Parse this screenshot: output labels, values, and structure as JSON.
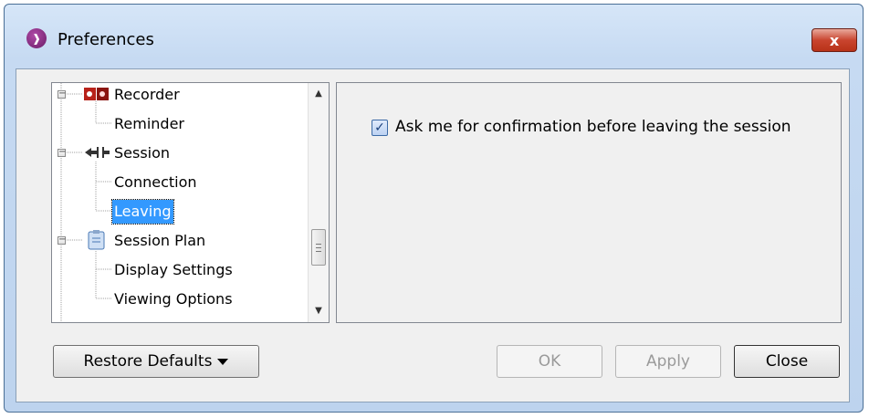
{
  "window": {
    "title": "Preferences",
    "close_glyph": "x",
    "app_icon": "app-logo-icon"
  },
  "tree": {
    "items": [
      {
        "label": "Recorder",
        "level": 0,
        "expanded": true,
        "icon": "recorder-icon"
      },
      {
        "label": "Reminder",
        "level": 1
      },
      {
        "label": "Session",
        "level": 0,
        "expanded": true,
        "icon": "session-plug-icon"
      },
      {
        "label": "Connection",
        "level": 1
      },
      {
        "label": "Leaving",
        "level": 1,
        "selected": true
      },
      {
        "label": "Session Plan",
        "level": 0,
        "expanded": true,
        "icon": "clipboard-icon"
      },
      {
        "label": "Display Settings",
        "level": 1
      },
      {
        "label": "Viewing Options",
        "level": 1
      }
    ]
  },
  "panel": {
    "checkbox_label": "Ask me for confirmation before leaving the session",
    "checkbox_checked": true
  },
  "buttons": {
    "restore_defaults": "Restore Defaults",
    "ok": "OK",
    "apply": "Apply",
    "close": "Close"
  },
  "colors": {
    "selection": "#3399ff",
    "title_bar": "#c6daf2",
    "close_button": "#c9452f"
  }
}
